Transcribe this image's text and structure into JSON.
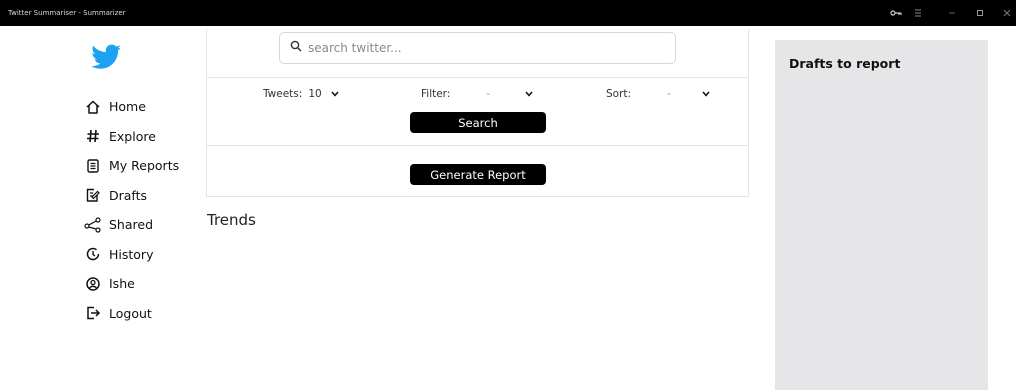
{
  "window": {
    "title": "Twitter Summariser - Summarizer",
    "controls": [
      "key-icon",
      "menu-icon",
      "minimize-icon",
      "maximize-icon",
      "close-icon"
    ]
  },
  "sidebar": {
    "logo": "twitter-bird-icon",
    "items": [
      {
        "label": "Home",
        "icon": "home-icon"
      },
      {
        "label": "Explore",
        "icon": "hashtag-icon"
      },
      {
        "label": "My Reports",
        "icon": "report-icon"
      },
      {
        "label": "Drafts",
        "icon": "drafts-icon"
      },
      {
        "label": "Shared",
        "icon": "share-icon"
      },
      {
        "label": "History",
        "icon": "history-icon"
      },
      {
        "label": "Ishe",
        "icon": "user-icon"
      },
      {
        "label": "Logout",
        "icon": "logout-icon"
      }
    ]
  },
  "search": {
    "placeholder": "search twitter...",
    "value": ""
  },
  "controls": {
    "tweets_label": "Tweets:",
    "tweets_value": "10",
    "filter_label": "Filter:",
    "filter_value": "-",
    "sort_label": "Sort:",
    "sort_value": "-"
  },
  "buttons": {
    "search": "Search",
    "generate_report": "Generate Report"
  },
  "trends": {
    "title": "Trends"
  },
  "drafts_panel": {
    "title": "Drafts to report"
  },
  "colors": {
    "titlebar": "#000000",
    "button": "#000000",
    "drafts_bg": "#e6e6e9",
    "twitter_blue": "#1da1f2"
  }
}
